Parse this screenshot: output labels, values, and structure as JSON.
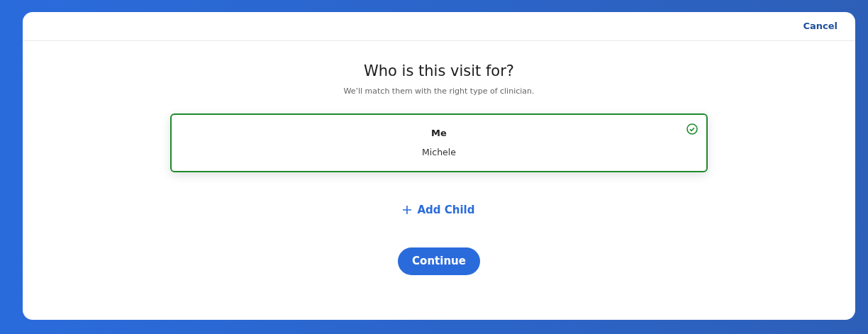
{
  "header": {
    "cancel": "Cancel"
  },
  "title": "Who is this visit for?",
  "subtitle": "We’ll match them with the right type of clinician.",
  "options": [
    {
      "label": "Me",
      "name": "Michele",
      "selected": true
    }
  ],
  "add_child": "Add Child",
  "continue": "Continue"
}
